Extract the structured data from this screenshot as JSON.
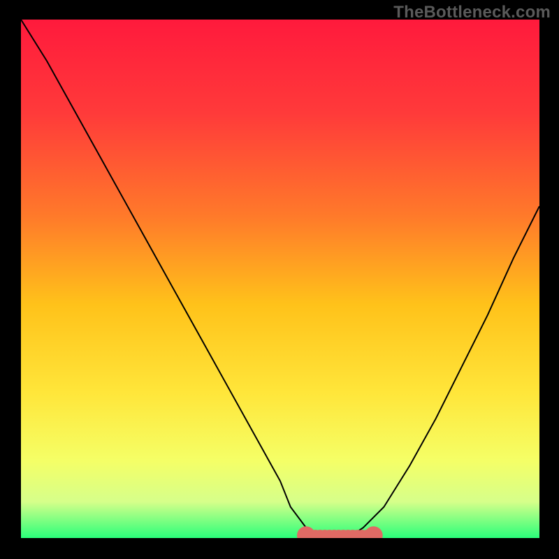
{
  "watermark": "TheBottleneck.com",
  "chart_data": {
    "type": "line",
    "title": "",
    "xlabel": "",
    "ylabel": "",
    "xlim": [
      0,
      100
    ],
    "ylim": [
      0,
      100
    ],
    "gradient_stops": [
      {
        "offset": 0.0,
        "color": "#ff1a3c"
      },
      {
        "offset": 0.18,
        "color": "#ff3a3a"
      },
      {
        "offset": 0.38,
        "color": "#ff7a2a"
      },
      {
        "offset": 0.55,
        "color": "#ffc21a"
      },
      {
        "offset": 0.72,
        "color": "#ffe63a"
      },
      {
        "offset": 0.85,
        "color": "#f5ff66"
      },
      {
        "offset": 0.93,
        "color": "#d6ff8a"
      },
      {
        "offset": 1.0,
        "color": "#2aff7a"
      }
    ],
    "series": [
      {
        "name": "bottleneck-curve",
        "color": "#000000",
        "x": [
          0,
          5,
          10,
          15,
          20,
          25,
          30,
          35,
          40,
          45,
          50,
          52,
          55,
          58,
          60,
          63,
          66,
          70,
          75,
          80,
          85,
          90,
          95,
          100
        ],
        "y": [
          100,
          92,
          83,
          74,
          65,
          56,
          47,
          38,
          29,
          20,
          11,
          6,
          2,
          0,
          0,
          0,
          2,
          6,
          14,
          23,
          33,
          43,
          54,
          64
        ]
      }
    ],
    "highlight": {
      "name": "optimal-range",
      "color": "#e06a64",
      "marker_radius": 1.1,
      "xrange": [
        55,
        68
      ],
      "y": 0.5
    }
  }
}
